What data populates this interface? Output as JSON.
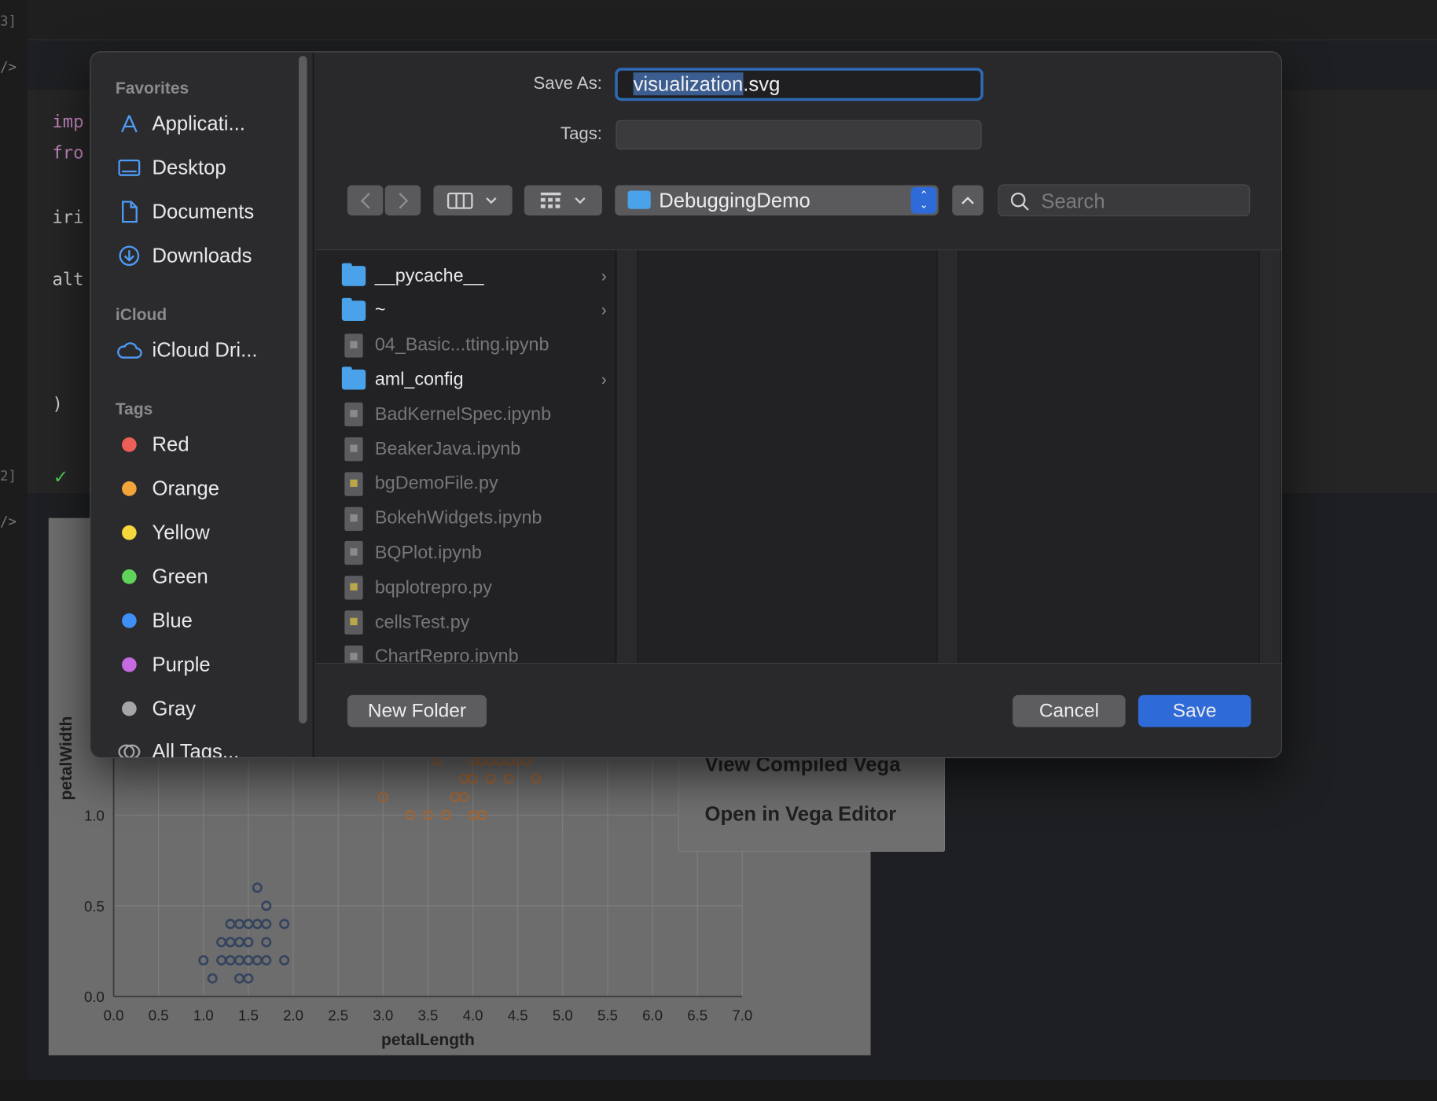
{
  "background": {
    "exec_counts": [
      "3]",
      "2]"
    ],
    "code_lines": [
      {
        "kw": "imp",
        "rest": ""
      },
      {
        "kw": "fro",
        "rest": ""
      },
      {
        "kw": "",
        "rest": "iri"
      },
      {
        "kw": "",
        "rest": "alt"
      },
      {
        "kw": "",
        "rest": ")"
      }
    ],
    "chart_data": {
      "type": "scatter",
      "xlabel": "petalLength",
      "ylabel": "petalWidth",
      "x_ticks": [
        "0.0",
        "0.5",
        "1.0",
        "1.5",
        "2.0",
        "2.5",
        "3.0",
        "3.5",
        "4.0",
        "4.5",
        "5.0",
        "5.5",
        "6.0",
        "6.5",
        "7.0"
      ],
      "y_ticks": [
        "0.0",
        "0.5",
        "1.0"
      ],
      "xlim": [
        0,
        7
      ],
      "series": [
        {
          "color": "#34435e",
          "points": [
            [
              1.0,
              0.2
            ],
            [
              1.1,
              0.1
            ],
            [
              1.2,
              0.2
            ],
            [
              1.3,
              0.2
            ],
            [
              1.3,
              0.3
            ],
            [
              1.3,
              0.4
            ],
            [
              1.4,
              0.2
            ],
            [
              1.4,
              0.1
            ],
            [
              1.4,
              0.3
            ],
            [
              1.5,
              0.2
            ],
            [
              1.5,
              0.1
            ],
            [
              1.5,
              0.4
            ],
            [
              1.5,
              0.3
            ],
            [
              1.6,
              0.2
            ],
            [
              1.6,
              0.6
            ],
            [
              1.6,
              0.4
            ],
            [
              1.7,
              0.2
            ],
            [
              1.7,
              0.4
            ],
            [
              1.7,
              0.5
            ],
            [
              1.7,
              0.3
            ],
            [
              1.9,
              0.2
            ],
            [
              1.9,
              0.4
            ],
            [
              1.2,
              0.3
            ],
            [
              1.4,
              0.4
            ]
          ]
        },
        {
          "color": "#a0683a",
          "points": [
            [
              3.0,
              1.1
            ],
            [
              3.3,
              1.0
            ],
            [
              3.5,
              1.0
            ],
            [
              3.7,
              1.0
            ],
            [
              3.6,
              1.3
            ],
            [
              3.8,
              1.1
            ],
            [
              3.9,
              1.1
            ],
            [
              3.9,
              1.2
            ],
            [
              4.0,
              1.0
            ],
            [
              4.1,
              1.0
            ],
            [
              4.0,
              1.3
            ],
            [
              4.0,
              1.2
            ],
            [
              4.1,
              1.3
            ],
            [
              4.2,
              1.3
            ],
            [
              4.2,
              1.2
            ],
            [
              4.3,
              1.3
            ],
            [
              4.4,
              1.3
            ],
            [
              4.4,
              1.2
            ],
            [
              4.5,
              1.3
            ],
            [
              4.6,
              1.3
            ],
            [
              4.7,
              1.2
            ]
          ]
        }
      ]
    },
    "context_menu": [
      "View Compiled Vega",
      "Open in Vega Editor"
    ]
  },
  "dialog": {
    "sidebar": {
      "favorites_header": "Favorites",
      "favorites": [
        {
          "label": "Applicati...",
          "icon": "applications-icon"
        },
        {
          "label": "Desktop",
          "icon": "desktop-icon"
        },
        {
          "label": "Documents",
          "icon": "documents-icon"
        },
        {
          "label": "Downloads",
          "icon": "downloads-icon"
        }
      ],
      "icloud_header": "iCloud",
      "icloud": [
        {
          "label": "iCloud Dri...",
          "icon": "cloud-icon"
        }
      ],
      "tags_header": "Tags",
      "tags": [
        {
          "label": "Red",
          "color": "#ec5f57"
        },
        {
          "label": "Orange",
          "color": "#f2a33a"
        },
        {
          "label": "Yellow",
          "color": "#f5d83b"
        },
        {
          "label": "Green",
          "color": "#5fd35a"
        },
        {
          "label": "Blue",
          "color": "#3f8ff7"
        },
        {
          "label": "Purple",
          "color": "#c56ae0"
        },
        {
          "label": "Gray",
          "color": "#a5a5a8"
        }
      ],
      "all_tags": "All Tags..."
    },
    "save_as_label": "Save As:",
    "filename_selected": "visualization",
    "filename_ext": ".svg",
    "tags_label": "Tags:",
    "location": "DebuggingDemo",
    "search_placeholder": "Search",
    "files": [
      {
        "name": "__pycache__",
        "kind": "dir"
      },
      {
        "name": "~",
        "kind": "dir"
      },
      {
        "name": "04_Basic...tting.ipynb",
        "kind": "nb"
      },
      {
        "name": "aml_config",
        "kind": "dir"
      },
      {
        "name": "BadKernelSpec.ipynb",
        "kind": "nb"
      },
      {
        "name": "BeakerJava.ipynb",
        "kind": "nb"
      },
      {
        "name": "bgDemoFile.py",
        "kind": "py"
      },
      {
        "name": "BokehWidgets.ipynb",
        "kind": "nb"
      },
      {
        "name": "BQPlot.ipynb",
        "kind": "nb"
      },
      {
        "name": "bqplotrepro.py",
        "kind": "py"
      },
      {
        "name": "cellsTest.py",
        "kind": "py"
      },
      {
        "name": "ChartRepro.ipynb",
        "kind": "nb"
      }
    ],
    "new_folder_label": "New Folder",
    "cancel_label": "Cancel",
    "save_label": "Save",
    "accent_color": "#2f6bd8"
  }
}
